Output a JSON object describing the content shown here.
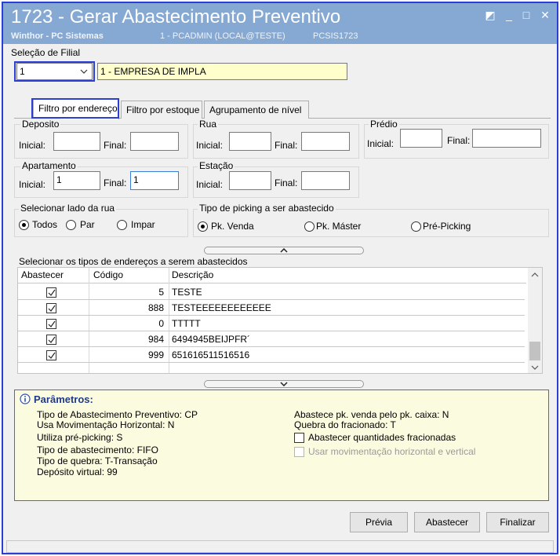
{
  "window": {
    "title": "1723 - Gerar Abastecimento Preventivo",
    "company": "Winthor - PC Sistemas",
    "user": "1 - PCADMIN (LOCAL@TESTE)",
    "program": "PCSIS1723",
    "controls": [
      "◩",
      "_",
      "□",
      "✕"
    ]
  },
  "filial": {
    "label": "Seleção de Filial",
    "code": "1",
    "name": "1 - EMPRESA DE IMPLA"
  },
  "tabs": [
    {
      "label": "Filtro por endereço",
      "active": true
    },
    {
      "label": "Filtro por estoque",
      "active": false
    },
    {
      "label": "Agrupamento de nível",
      "active": false
    }
  ],
  "filters": {
    "deposito": {
      "label": "Deposito",
      "inicial_label": "Inicial:",
      "final_label": "Final:",
      "inicial": "",
      "final": ""
    },
    "rua": {
      "label": "Rua",
      "inicial_label": "Inicial:",
      "final_label": "Final:",
      "inicial": "",
      "final": ""
    },
    "predio": {
      "label": "Prédio",
      "inicial_label": "Inicial:",
      "final_label": "Final:",
      "inicial": "",
      "final": ""
    },
    "apartamento": {
      "label": "Apartamento",
      "inicial_label": "Inicial:",
      "final_label": "Final:",
      "inicial": "1",
      "final": "1"
    },
    "estacao": {
      "label": "Estação",
      "inicial_label": "Inicial:",
      "final_label": "Final:",
      "inicial": "",
      "final": ""
    }
  },
  "lado_rua": {
    "label": "Selecionar lado da rua",
    "options": [
      {
        "label": "Todos",
        "selected": true
      },
      {
        "label": "Par",
        "selected": false
      },
      {
        "label": "Impar",
        "selected": false
      }
    ]
  },
  "picking": {
    "label": "Tipo de picking a ser abastecido",
    "options": [
      {
        "label": "Pk. Venda",
        "selected": true
      },
      {
        "label": "Pk. Máster",
        "selected": false
      },
      {
        "label": "Pré-Picking",
        "selected": false
      }
    ]
  },
  "enderecos": {
    "label": "Selecionar os tipos de endereços a serem abastecidos",
    "columns": [
      "Abastecer",
      "Código",
      "Descrição"
    ],
    "rows": [
      {
        "abastecer": true,
        "codigo": "5",
        "descricao": "TESTE"
      },
      {
        "abastecer": true,
        "codigo": "888",
        "descricao": "TESTEEEEEEEEEEEE"
      },
      {
        "abastecer": true,
        "codigo": "0",
        "descricao": "TTTTT"
      },
      {
        "abastecer": true,
        "codigo": "984",
        "descricao": "6494945BEIJPFR´"
      },
      {
        "abastecer": true,
        "codigo": "999",
        "descricao": "651616511516516"
      }
    ]
  },
  "parametros": {
    "title": "Parâmetros:",
    "left": [
      "Tipo de Abastecimento Preventivo: CP",
      "Usa Movimentação Horizontal: N",
      "Utiliza pré-picking: S",
      "Tipo de abastecimento: FIFO",
      "Tipo de quebra: T-Transação",
      "Depósito virtual: 99"
    ],
    "right": [
      "Abastece pk. venda pelo pk. caixa: N",
      "Quebra do fracionado: T"
    ],
    "check_fracionadas": "Abastecer quantidades fracionadas",
    "check_horizontal": "Usar movimentação horizontal e vertical"
  },
  "buttons": {
    "previa": "Prévia",
    "abastecer": "Abastecer",
    "finalizar": "Finalizar"
  },
  "colors": {
    "titlebar": "#86a9d3",
    "highlight": "#2b3fd6",
    "input_yellow": "#ffffcc",
    "panel_yellow": "#fbfbe0"
  }
}
